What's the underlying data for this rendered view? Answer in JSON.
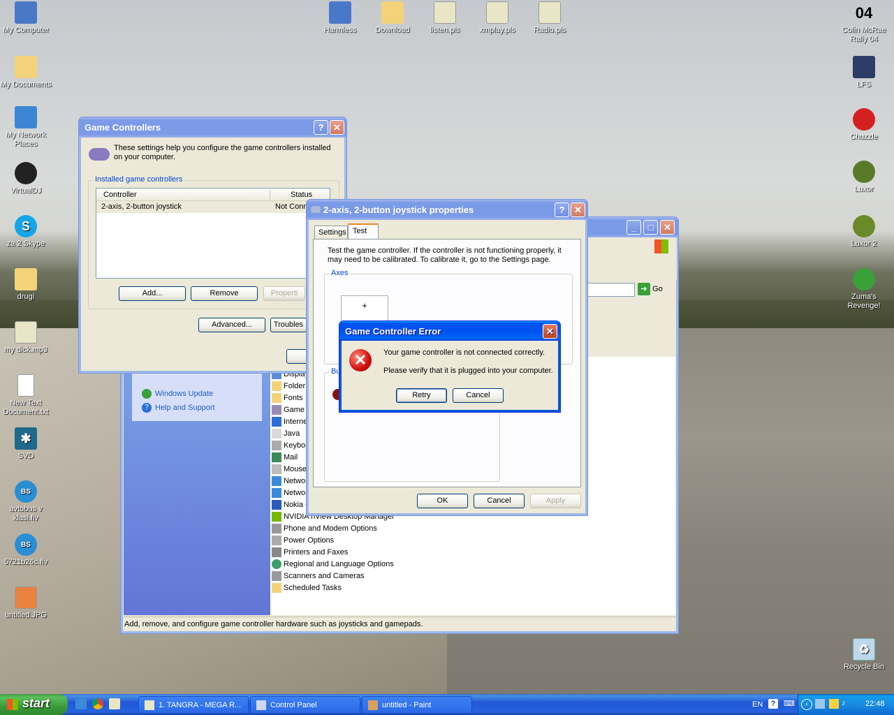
{
  "desktop": {
    "icons_left": [
      {
        "label": "My Computer",
        "icon": "computer-icon"
      },
      {
        "label": "My Documents",
        "icon": "folder-icon"
      },
      {
        "label": "My Network Places",
        "icon": "network-icon"
      },
      {
        "label": "VirtualDJ",
        "icon": "virtualdj-icon"
      },
      {
        "label": "za 2 Skype",
        "icon": "skype-icon"
      },
      {
        "label": "drugi",
        "icon": "folder-icon"
      },
      {
        "label": "my dick.mp3",
        "icon": "audio-file-icon"
      },
      {
        "label": "New Text Document.txt",
        "icon": "text-file-icon"
      },
      {
        "label": "SVD",
        "icon": "spider-icon"
      },
      {
        "label": "avtobus v klasi.flv",
        "icon": "flv-icon"
      },
      {
        "label": "5721b26c.flv",
        "icon": "flv-icon"
      },
      {
        "label": "untitled.JPG",
        "icon": "image-icon"
      }
    ],
    "icons_top": [
      {
        "label": "Harmless",
        "icon": "computer-icon"
      },
      {
        "label": "Download",
        "icon": "folder-icon"
      },
      {
        "label": "listen.pls",
        "icon": "playlist-icon"
      },
      {
        "label": "xmplay.pls",
        "icon": "playlist-icon"
      },
      {
        "label": "Radio.pls",
        "icon": "playlist-icon"
      }
    ],
    "icons_right": [
      {
        "label": "Colin McRae Rally 04",
        "icon": "game-icon",
        "glyph": "04"
      },
      {
        "label": "LFS",
        "icon": "game-icon"
      },
      {
        "label": "Chuzzle",
        "icon": "game-icon"
      },
      {
        "label": "Luxor",
        "icon": "game-icon"
      },
      {
        "label": "Luxor 2",
        "icon": "game-icon"
      },
      {
        "label": "Zuma's Revenge!",
        "icon": "game-icon"
      },
      {
        "label": "Recycle Bin",
        "icon": "recycle-bin-icon"
      }
    ]
  },
  "game_controllers": {
    "title": "Game Controllers",
    "intro": "These settings help you configure the game controllers installed on your computer.",
    "group_label": "Installed game controllers",
    "columns": [
      "Controller",
      "Status"
    ],
    "rows": [
      {
        "controller": "2-axis, 2-button joystick",
        "status": "Not Conn"
      }
    ],
    "buttons": {
      "add": "Add...",
      "remove": "Remove",
      "properties": "Properti",
      "advanced": "Advanced...",
      "troubleshoot": "Troubles"
    }
  },
  "control_panel": {
    "see_also": "See Also",
    "links": [
      "Windows Update",
      "Help and Support"
    ],
    "items": [
      "Display",
      "Folder O",
      "Fonts",
      "Game C",
      "Interne",
      "Java",
      "Keyboa",
      "Mail",
      "Mouse",
      "Networ",
      "Networ",
      "Nokia C",
      "NVIDIA nView Desktop Manager",
      "Phone and Modem Options",
      "Power Options",
      "Printers and Faxes",
      "Regional and Language Options",
      "Scanners and Cameras",
      "Scheduled Tasks"
    ],
    "go_label": "Go",
    "status_text": "Add, remove, and configure game controller hardware such as joysticks and gamepads."
  },
  "joystick_props": {
    "title": "2-axis, 2-button joystick properties",
    "tabs": [
      "Settings",
      "Test"
    ],
    "description": "Test the game controller.  If the controller is not functioning properly, it may need to be calibrated.  To calibrate it, go to the Settings page.",
    "axes_label": "Axes",
    "crosshair": "+",
    "buttons_label": "Bu",
    "ok": "OK",
    "cancel": "Cancel",
    "apply": "Apply"
  },
  "error_dialog": {
    "title": "Game Controller Error",
    "line1": "Your game controller is not connected correctly.",
    "line2": "Please verify that it is plugged into your computer.",
    "retry": "Retry",
    "cancel": "Cancel"
  },
  "taskbar": {
    "start": "start",
    "tasks": [
      "1. TANGRA - MEGA R...",
      "Control Panel",
      "untitled - Paint"
    ],
    "language": "EN",
    "clock": "22:48"
  }
}
